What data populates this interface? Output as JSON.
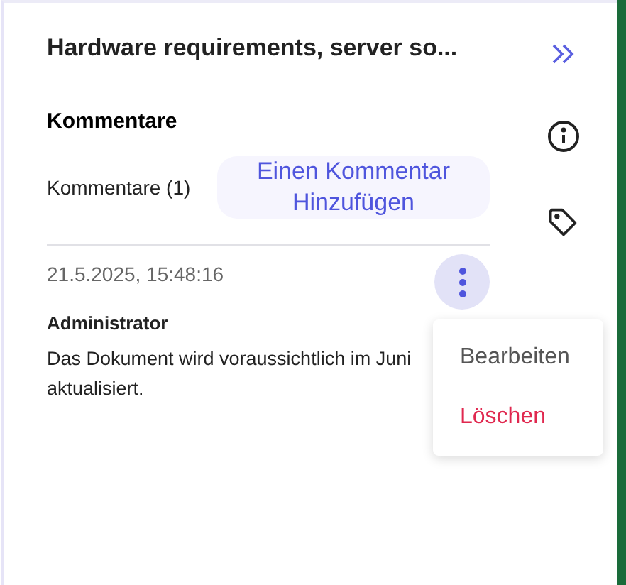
{
  "panel": {
    "title": "Hardware requirements, server so..."
  },
  "comments": {
    "heading": "Kommentare",
    "count_label": "Kommentare (1)",
    "add_button": "Einen Kommentar Hinzufügen",
    "items": [
      {
        "timestamp": "21.5.2025, 15:48:16",
        "author": "Administrator",
        "text": "Das Dokument wird voraussichtlich im Juni aktualisiert."
      }
    ]
  },
  "menu": {
    "items": [
      {
        "label": "Bearbeiten",
        "kind": "normal"
      },
      {
        "label": "Löschen",
        "kind": "danger"
      }
    ]
  }
}
